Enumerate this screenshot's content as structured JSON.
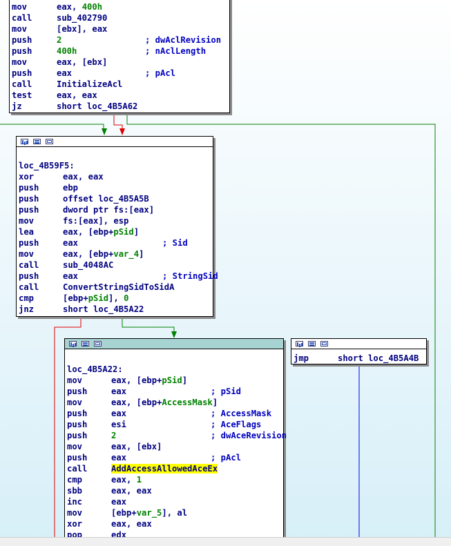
{
  "blocks": {
    "top": {
      "lines": [
        {
          "m": "mov",
          "o": [
            {
              "t": "eax, "
            },
            {
              "t": "400h",
              "c": "g"
            }
          ],
          "c": ""
        },
        {
          "m": "call",
          "o": [
            {
              "t": "sub_402790"
            }
          ],
          "c": ""
        },
        {
          "m": "mov",
          "o": [
            {
              "t": "[ebx], eax"
            }
          ],
          "c": ""
        },
        {
          "m": "push",
          "o": [
            {
              "t": "2",
              "c": "g"
            }
          ],
          "c": "; dwAclRevision"
        },
        {
          "m": "push",
          "o": [
            {
              "t": "400h",
              "c": "g"
            }
          ],
          "c": "; nAclLength"
        },
        {
          "m": "mov",
          "o": [
            {
              "t": "eax, [ebx]"
            }
          ],
          "c": ""
        },
        {
          "m": "push",
          "o": [
            {
              "t": "eax"
            }
          ],
          "c": "; pAcl"
        },
        {
          "m": "call",
          "o": [
            {
              "t": "InitializeAcl"
            }
          ],
          "c": ""
        },
        {
          "m": "test",
          "o": [
            {
              "t": "eax, eax"
            }
          ],
          "c": ""
        },
        {
          "m": "jz",
          "o": [
            {
              "t": "short loc_4B5A62"
            }
          ],
          "c": ""
        }
      ]
    },
    "mid": {
      "label": "loc_4B59F5:",
      "lines": [
        {
          "m": "xor",
          "o": [
            {
              "t": "eax, eax"
            }
          ],
          "c": ""
        },
        {
          "m": "push",
          "o": [
            {
              "t": "ebp"
            }
          ],
          "c": ""
        },
        {
          "m": "push",
          "o": [
            {
              "t": "offset loc_4B5A5B"
            }
          ],
          "c": ""
        },
        {
          "m": "push",
          "o": [
            {
              "t": "dword ptr fs:[eax]"
            }
          ],
          "c": ""
        },
        {
          "m": "mov",
          "o": [
            {
              "t": "fs:[eax], esp"
            }
          ],
          "c": ""
        },
        {
          "m": "lea",
          "o": [
            {
              "t": "eax, [ebp+"
            },
            {
              "t": "pSid",
              "c": "g"
            },
            {
              "t": "]"
            }
          ],
          "c": ""
        },
        {
          "m": "push",
          "o": [
            {
              "t": "eax"
            }
          ],
          "c": "; Sid"
        },
        {
          "m": "mov",
          "o": [
            {
              "t": "eax, [ebp+"
            },
            {
              "t": "var_4",
              "c": "g"
            },
            {
              "t": "]"
            }
          ],
          "c": ""
        },
        {
          "m": "call",
          "o": [
            {
              "t": "sub_4048AC"
            }
          ],
          "c": ""
        },
        {
          "m": "push",
          "o": [
            {
              "t": "eax"
            }
          ],
          "c": "; StringSid"
        },
        {
          "m": "call",
          "o": [
            {
              "t": "ConvertStringSidToSidA"
            }
          ],
          "c": ""
        },
        {
          "m": "cmp",
          "o": [
            {
              "t": "[ebp+"
            },
            {
              "t": "pSid",
              "c": "g"
            },
            {
              "t": "], "
            },
            {
              "t": "0",
              "c": "g"
            }
          ],
          "c": ""
        },
        {
          "m": "jnz",
          "o": [
            {
              "t": "short loc_4B5A22"
            }
          ],
          "c": ""
        }
      ]
    },
    "main": {
      "label": "loc_4B5A22:",
      "lines": [
        {
          "m": "mov",
          "o": [
            {
              "t": "eax, [ebp+"
            },
            {
              "t": "pSid",
              "c": "g"
            },
            {
              "t": "]"
            }
          ],
          "c": ""
        },
        {
          "m": "push",
          "o": [
            {
              "t": "eax"
            }
          ],
          "c": "; pSid"
        },
        {
          "m": "mov",
          "o": [
            {
              "t": "eax, [ebp+"
            },
            {
              "t": "AccessMask",
              "c": "g"
            },
            {
              "t": "]"
            }
          ],
          "c": ""
        },
        {
          "m": "push",
          "o": [
            {
              "t": "eax"
            }
          ],
          "c": "; AccessMask"
        },
        {
          "m": "push",
          "o": [
            {
              "t": "esi"
            }
          ],
          "c": "; AceFlags"
        },
        {
          "m": "push",
          "o": [
            {
              "t": "2",
              "c": "g"
            }
          ],
          "c": "; dwAceRevision"
        },
        {
          "m": "mov",
          "o": [
            {
              "t": "eax, [ebx]"
            }
          ],
          "c": ""
        },
        {
          "m": "push",
          "o": [
            {
              "t": "eax"
            }
          ],
          "c": "; pAcl"
        },
        {
          "m": "call",
          "o": [
            {
              "t": "AddAccessAllowedAceEx",
              "c": "hl"
            }
          ],
          "c": ""
        },
        {
          "m": "cmp",
          "o": [
            {
              "t": "eax, "
            },
            {
              "t": "1",
              "c": "g"
            }
          ],
          "c": ""
        },
        {
          "m": "sbb",
          "o": [
            {
              "t": "eax, eax"
            }
          ],
          "c": ""
        },
        {
          "m": "inc",
          "o": [
            {
              "t": "eax"
            }
          ],
          "c": ""
        },
        {
          "m": "mov",
          "o": [
            {
              "t": "[ebp+"
            },
            {
              "t": "var_5",
              "c": "g"
            },
            {
              "t": "], al"
            }
          ],
          "c": ""
        },
        {
          "m": "xor",
          "o": [
            {
              "t": "eax, eax"
            }
          ],
          "c": ""
        },
        {
          "m": "pop",
          "o": [
            {
              "t": "edx"
            }
          ],
          "c": ""
        }
      ]
    },
    "jmp": {
      "lines": [
        {
          "m": "jmp",
          "o": [
            {
              "t": "short loc_4B5A4B"
            }
          ],
          "c": ""
        }
      ]
    }
  },
  "colors": {
    "true_edge": "#008000",
    "false_edge": "#e00000",
    "uncond_edge": "#0000ff",
    "highlight": "#ffff00",
    "active_titlebar": "#a8d3d3"
  },
  "icons": [
    "graph-icon",
    "flow-icon",
    "text-icon"
  ]
}
